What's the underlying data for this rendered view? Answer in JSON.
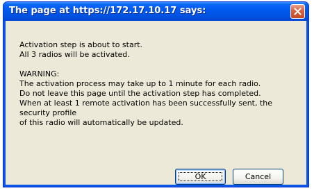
{
  "dialog": {
    "title": "The page at https://172.17.10.17 says:",
    "close_icon": "close-icon",
    "message_lines": [
      "Activation step is about to start.",
      "All 3 radios will be activated.",
      "",
      "WARNING:",
      "The activation process may take up to 1 minute for each radio.",
      "Do not leave this page until the activation step has completed.",
      "When at least 1 remote activation has been successfully sent, the",
      "security profile",
      "of this radio will automatically be updated."
    ],
    "ok_label": "OK",
    "cancel_label": "Cancel"
  },
  "colors": {
    "titlebar": "#0054e3",
    "dialog_body": "#ece9d8",
    "close_button": "#d8613f"
  }
}
